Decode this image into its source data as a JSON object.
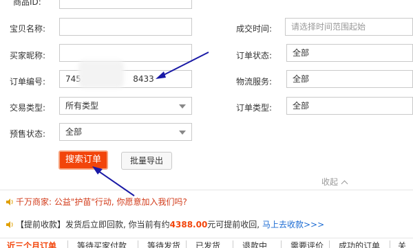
{
  "form": {
    "item_id_label": "商品ID:",
    "item_name_label": "宝贝名称:",
    "buyer_nick_label": "买家昵称:",
    "order_no_label": "订单编号:",
    "order_no_prefix": "7451",
    "order_no_suffix": "8433",
    "trade_type_label": "交易类型:",
    "trade_type_value": "所有类型",
    "presale_label": "预售状态:",
    "presale_value": "全部",
    "deal_time_label": "成交时间:",
    "deal_time_placeholder": "请选择时间范围起始",
    "order_status_label": "订单状态:",
    "order_status_value": "全部",
    "logistics_label": "物流服务:",
    "logistics_value": "全部",
    "order_type_label": "订单类型:",
    "order_type_value": "全部"
  },
  "actions": {
    "search_label": "搜索订单",
    "export_label": "批量导出",
    "collapse_label": "收起"
  },
  "notices": {
    "charity": "千万商家: 公益\"护苗\"行动, 你愿意加入我们吗?",
    "advance_pre": "【提前收款】发货后立即回款, 你当前有约",
    "advance_amount": "4388.00",
    "advance_post": "元可提前收回,",
    "advance_link": "马上去收款>>>"
  },
  "tabs": [
    "近三个月订单",
    "等待买家付款",
    "等待发货",
    "已发货",
    "退款中",
    "需要评价",
    "成功的订单",
    "关"
  ],
  "colors": {
    "accent": "#f2450b",
    "arrow": "#1a1aa6",
    "link": "#1b6bd3"
  }
}
